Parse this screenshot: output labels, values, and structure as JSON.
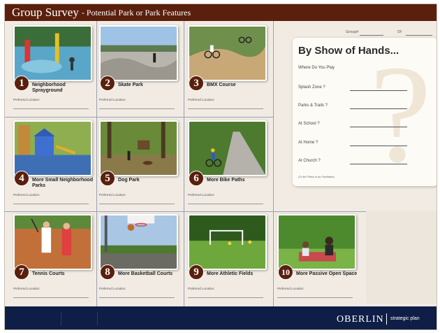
{
  "header": {
    "title": "Group Survey",
    "subtitle": "- Potential Park or Park Features"
  },
  "group": {
    "group_label": "Group#",
    "of_label": "Of"
  },
  "pref_label": "Preferred Location:",
  "cards": [
    {
      "number": "1",
      "label": "Neighborhood Sprayground",
      "icon": "sprayground-photo"
    },
    {
      "number": "2",
      "label": "Skate Park",
      "icon": "skate-park-photo"
    },
    {
      "number": "3",
      "label": "BMX Course",
      "icon": "bmx-photo"
    },
    {
      "number": "4",
      "label": "More Small Neighborhood Parks",
      "icon": "playground-photo"
    },
    {
      "number": "5",
      "label": "Dog Park",
      "icon": "dog-park-photo"
    },
    {
      "number": "6",
      "label": "More Bike Paths",
      "icon": "bike-path-photo"
    },
    {
      "number": "7",
      "label": "Tennis Courts",
      "icon": "tennis-photo"
    },
    {
      "number": "8",
      "label": "More Basketball Courts",
      "icon": "basketball-photo"
    },
    {
      "number": "9",
      "label": "More Athletic Fields",
      "icon": "athletic-field-photo"
    },
    {
      "number": "10",
      "label": "More Passive Open Space",
      "icon": "open-space-photo"
    }
  ],
  "show_of_hands": {
    "title": "By Show of Hands...",
    "where": "Where Do You Play",
    "rows": [
      "Splash Zone ?",
      "Parks & Trails ?",
      "At School ?",
      "At Home ?",
      "At Church ?"
    ],
    "footnote": "(To Be Filled-In by Facilitator)"
  },
  "footer": {
    "logo": "OBERLIN",
    "sub": "strategic plan"
  },
  "colors": {
    "brand": "#5a200d",
    "footer": "#0f1e46",
    "background": "#f1ebe3"
  }
}
